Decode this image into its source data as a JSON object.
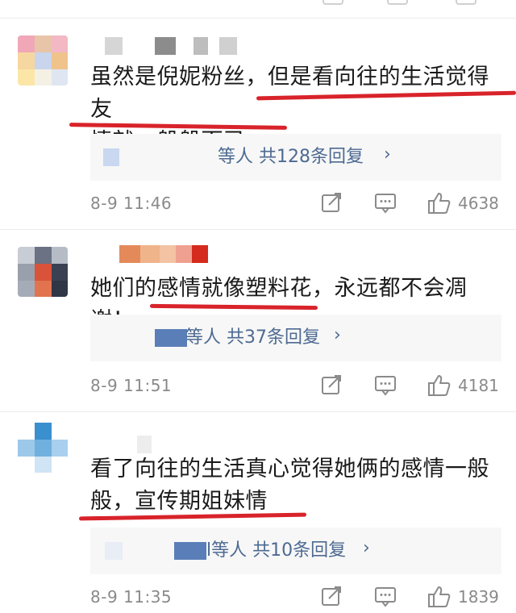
{
  "colors": {
    "accent_underline": "#d8232a",
    "link_blue": "#4d6a92",
    "muted_gray": "#8a8a8a",
    "reply_bg": "#f7f7f7"
  },
  "comments": [
    {
      "text_line1": "虽然是倪妮粉丝，但是看向往的生活觉得友",
      "text_line2": "情就一般般而已",
      "reply_summary": "等人 共128条回复",
      "reply_chevron": "›",
      "time": "8-9 11:46",
      "like_count": "4638",
      "icons": [
        "share-icon",
        "comment-icon",
        "like-icon"
      ]
    },
    {
      "text_line1": "她们的感情就像塑料花，永远都不会凋谢！",
      "reply_summary": "等人 共37条回复",
      "reply_chevron": "›",
      "time": "8-9 11:51",
      "like_count": "4181",
      "icons": [
        "share-icon",
        "comment-icon",
        "like-icon"
      ]
    },
    {
      "text_line1": "看了向往的生活真心觉得她俩的感情一般",
      "text_line2": "般，宣传期姐妹情",
      "reply_summary": "l等人 共10条回复",
      "reply_chevron": "›",
      "time": "8-9 11:35",
      "like_count": "1839",
      "icons": [
        "share-icon",
        "comment-icon",
        "like-icon"
      ]
    }
  ]
}
